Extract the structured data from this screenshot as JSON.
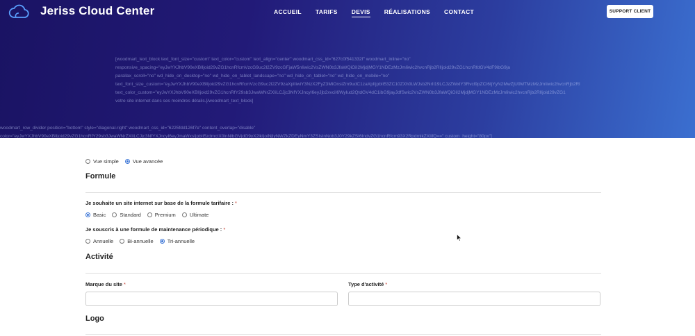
{
  "header": {
    "brand": "Jeriss Cloud Center",
    "nav": [
      "ACCUEIL",
      "TARIFS",
      "DEVIS",
      "RÉALISATIONS",
      "CONTACT"
    ],
    "active_nav": "DEVIS",
    "support_button": "SUPPORT CLIENT"
  },
  "hero": {
    "shortcode_lines": [
      "[woodmart_text_block text_font_size=\"custom\" text_color=\"custom\" text_align=\"center\" woodmart_css_id=\"627c0f541332f\" woodmart_inline=\"no\"",
      "responsive_spacing=\"eyJwYXJhbV90eXBlIjoid29vZG1hcnRfcmVzcG9uc2l2ZV9zcGFjaW5nIiwic2VsZWN0b3JfaWQiOiI2MjdjMGY1NDEzMzJmIiwic2hvcnRjb2RlIjoid29vZG1hcnRfdGV4dF9ibG9ja",
      "parallax_scroll=\"no\" wd_hide_on_desktop=\"no\" wd_hide_on_tablet_landscape=\"no\" wd_hide_on_tablet=\"no\" wd_hide_on_mobile=\"no\"",
      "text_font_size_custom=\"eyJwYXJhbV90eXBlIjoid29vZG1hcnRfcmVzcG9uc2l2ZV9zaXplIiwiY3NzX2FyZ3MiOnsiZm9udC1zaXplIjpbIi53ZC10ZXh0LWJsb2NrIl19LCJzZWxlY3Rvcl9pZCI6IjYyN2MwZjU0MTMzMzJmIiwic2hvcnRjb2Rl",
      "text_color_custom=\"eyJwYXJhbV90eXBlIjoid29vZG1hcnRfY29sb3JwaWNrZXIiLCJjc3NfYXJncyI6eyJjb2xvciI6WyIud2QtdGV4dC1ibG9jayJdfSwic2VsZWN0b3JfaWQiOiI2MjdjMGY1NDEzMzJmIiwic2hvcnRjb2RlIjoid29vZG1",
      "votre site internet dans ses moindres détails.[/woodmart_text_block]"
    ],
    "divider_lines": [
      "woodmart_row_divider position=\"bottom\" style=\"diagonal-right\" woodmart_css_id=\"6225fdd126f7e\" content_overlap=\"disable\"",
      "color=\"eyJwYXJhbV90eXBlIjoid29vZG1hcnRfY29sb3JwaWNrZXIiLCJjc3NfYXJncyI6eyJmaWxsIjpbIi5zdmctX0lnNlbGVjdG9yX2lkIjoiNjIyNWZkZDEyNmY3ZSIsInNob3J0Y29kZSI6IndvZG1hcnRfcm93X2RpdmlkZXIifQ==\" custom_height=\"80px\"]"
    ]
  },
  "form": {
    "view_options": [
      "Vue simple",
      "Vue avancée"
    ],
    "view_selected": 1,
    "sections": {
      "formule": "Formule",
      "activite": "Activité",
      "logo": "Logo"
    },
    "q1": {
      "label": "Je souhaite un site internet sur base de la formule tarifaire :",
      "options": [
        "Basic",
        "Standard",
        "Premium",
        "Ultimate"
      ],
      "selected": 0
    },
    "q2": {
      "label": "Je souscris à une formule de maintenance périodique :",
      "options": [
        "Annuelle",
        "Bi-annuelle",
        "Tri-annuelle"
      ],
      "selected": 2
    },
    "fields": {
      "marque_label": "Marque du site",
      "marque_value": "",
      "type_label": "Type d'activité",
      "type_value": ""
    },
    "required_mark": "*"
  },
  "colors": {
    "accent": "#3a74d6",
    "hero_start": "#1a1363",
    "hero_end": "#3b6fd0"
  },
  "icons": {
    "logo": "cloud-icon"
  }
}
